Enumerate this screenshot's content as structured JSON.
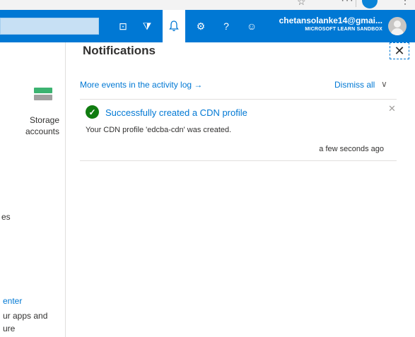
{
  "topbar": {
    "account_email": "chetansolanke14@gmai...",
    "account_tenant": "MICROSOFT LEARN SANDBOX",
    "icons": {
      "shell": "⊡",
      "filter": "⧩",
      "bell": "🔔",
      "gear": "⚙",
      "help": "?",
      "smile": "☺"
    }
  },
  "left_blade": {
    "storage_label": "Storage accounts",
    "frag1": "es",
    "frag2": "enter",
    "frag3": "ur apps and",
    "frag4": "ure"
  },
  "notifications": {
    "title": "Notifications",
    "close_glyph": "✕",
    "activity_link": "More events in the activity log →",
    "dismiss_all": "Dismiss all",
    "dismiss_chevron": "∨",
    "items": [
      {
        "status_glyph": "✓",
        "title": "Successfully created a CDN profile",
        "body": "Your CDN profile 'edcba-cdn' was created.",
        "time": "a few seconds ago",
        "close_glyph": "✕"
      }
    ]
  },
  "colors": {
    "brand": "#0078d4",
    "success": "#107c10"
  }
}
